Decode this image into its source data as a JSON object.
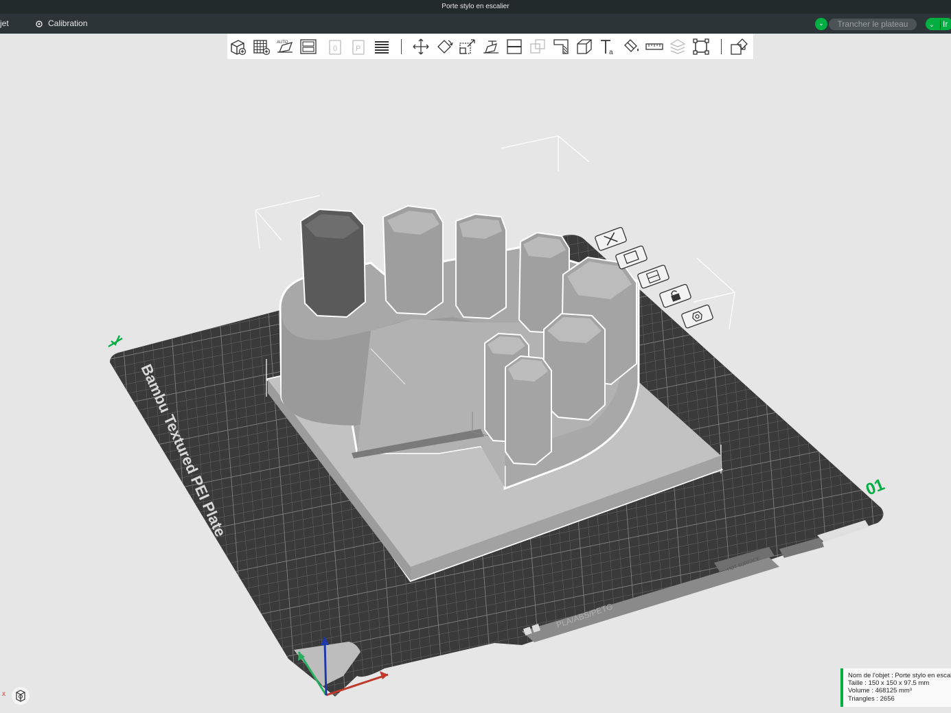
{
  "window": {
    "title": "Porte stylo en escalier"
  },
  "menu": {
    "project_partial": "jet",
    "calibration": "Calibration"
  },
  "header": {
    "slice_label": "Trancher le plateau",
    "print_partial": "Ir"
  },
  "toolbar": {
    "icons": [
      "add-object-icon",
      "grid-arrange-icon",
      "auto-orient-icon",
      "plate-layout-icon",
      "copy-plate-icon",
      "paste-icon",
      "layers-icon",
      "move-icon",
      "rotate-icon",
      "scale-icon",
      "lay-on-face-icon",
      "cut-icon",
      "boolean-icon",
      "support-paint-icon",
      "seam-paint-icon",
      "text-tool-icon",
      "color-paint-icon",
      "measure-icon",
      "assembly-icon",
      "fit-view-icon",
      "explode-view-icon"
    ]
  },
  "plate": {
    "name": "Bambu Textured PEI Plate",
    "number": "01",
    "materials": "PLA/ABS/PETG",
    "hot_surface": "HOT SURFACE",
    "accent_color": "#00ae42"
  },
  "object_info": {
    "name": "Nom de l'objet : Porte stylo en escalier",
    "size": "Taille : 150 x 150 x 97.5 mm",
    "volume": "Volume : 468125 mm³",
    "triangles": "Triangles : 2656"
  },
  "axis": {
    "x": "x"
  }
}
